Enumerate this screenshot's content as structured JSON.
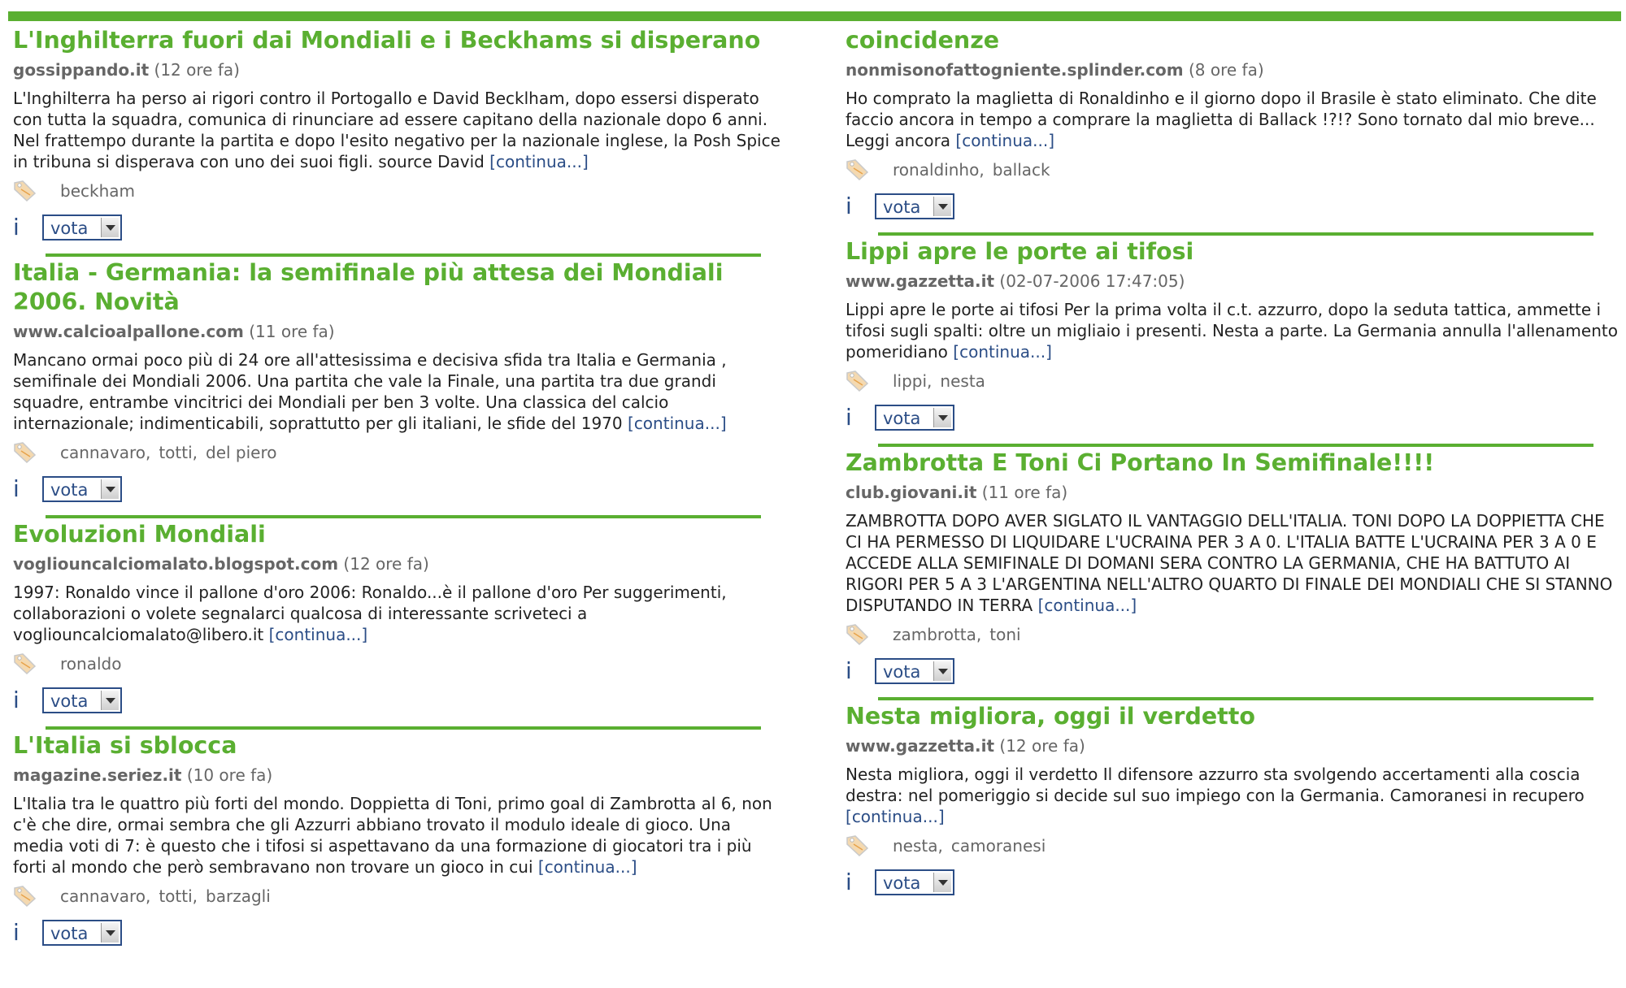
{
  "colors": {
    "accent_green": "#5aaf31",
    "link_blue": "#2b4d86",
    "meta_gray": "#666666"
  },
  "labels": {
    "info_icon": "i",
    "vota": "vota",
    "continua": "continua..."
  },
  "left_column": [
    {
      "title": "L'Inghilterra fuori dai Mondiali e i Beckhams si disperano",
      "source": "gossippando.it",
      "time": "(12 ore fa)",
      "body": "L'Inghilterra ha perso ai rigori contro il Portogallo e David Becklham, dopo essersi disperato con tutta la squadra, comunica di rinunciare ad essere capitano della nazionale dopo 6 anni. Nel frattempo durante la partita e dopo l'esito negativo per la nazionale inglese, la Posh Spice in tribuna si disperava con uno dei suoi figli. source David ",
      "tags": [
        "beckham"
      ]
    },
    {
      "title": "Italia - Germania: la semifinale più attesa dei Mondiali 2006. Novità",
      "source": "www.calcioalpallone.com",
      "time": "(11 ore fa)",
      "body": "Mancano ormai poco più di 24 ore all'attesissima e decisiva sfida tra Italia e Germania , semifinale dei Mondiali 2006. Una partita che vale la Finale, una partita tra due grandi squadre, entrambe vincitrici dei Mondiali per ben 3 volte. Una classica del calcio internazionale; indimenticabili, soprattutto per gli italiani, le sfide del 1970 ",
      "tags": [
        "cannavaro,",
        "totti,",
        "del piero"
      ]
    },
    {
      "title": "Evoluzioni Mondiali",
      "source": "vogliouncalciomalato.blogspot.com",
      "time": "(12 ore fa)",
      "body": "1997: Ronaldo vince il pallone d'oro 2006: Ronaldo...è il pallone d'oro Per suggerimenti, collaborazioni o volete segnalarci qualcosa di interessante scriveteci a vogliouncalciomalato@libero.it ",
      "tags": [
        "ronaldo"
      ]
    },
    {
      "title": "L'Italia si sblocca",
      "source": "magazine.seriez.it",
      "time": "(10 ore fa)",
      "body": "L'Italia tra le quattro più forti del mondo. Doppietta di Toni, primo goal di Zambrotta al 6, non c'è che dire, ormai sembra che gli Azzurri abbiano trovato il modulo ideale di gioco. Una media voti di 7: è questo che i tifosi si aspettavano da una formazione di giocatori tra i più forti al mondo che però sembravano non trovare un gioco in cui ",
      "tags": [
        "cannavaro,",
        "totti,",
        "barzagli"
      ]
    }
  ],
  "right_column": [
    {
      "title": "coincidenze",
      "source": "nonmisonofattogniente.splinder.com",
      "time": "(8 ore fa)",
      "body": "Ho comprato la maglietta di Ronaldinho e il giorno dopo il Brasile è stato eliminato. Che dite faccio ancora in tempo a comprare la maglietta di Ballack !?!? Sono tornato dal mio breve... Leggi ancora ",
      "tags": [
        "ronaldinho,",
        "ballack"
      ]
    },
    {
      "title": "Lippi apre le porte ai tifosi",
      "source": "www.gazzetta.it",
      "time": "(02-07-2006 17:47:05)",
      "body": "Lippi apre le porte ai tifosi Per la prima volta il c.t. azzurro, dopo la seduta tattica, ammette i tifosi sugli spalti: oltre un migliaio i presenti. Nesta a parte. La Germania annulla l'allenamento pomeridiano ",
      "tags": [
        "lippi,",
        "nesta"
      ]
    },
    {
      "title": "Zambrotta E Toni Ci Portano In Semifinale!!!!",
      "source": "club.giovani.it",
      "time": "(11 ore fa)",
      "body": "ZAMBROTTA DOPO AVER SIGLATO IL VANTAGGIO DELL'ITALIA. TONI DOPO LA DOPPIETTA CHE CI HA PERMESSO DI LIQUIDARE L'UCRAINA PER 3 A 0. L'ITALIA BATTE L'UCRAINA PER 3 A 0 E ACCEDE ALLA SEMIFINALE DI DOMANI SERA CONTRO LA GERMANIA, CHE HA BATTUTO AI RIGORI PER 5 A 3 L'ARGENTINA NELL'ALTRO QUARTO DI FINALE DEI MONDIALI CHE SI STANNO DISPUTANDO IN TERRA ",
      "tags": [
        "zambrotta,",
        "toni"
      ]
    },
    {
      "title": "Nesta migliora, oggi il verdetto",
      "source": "www.gazzetta.it",
      "time": "(12 ore fa)",
      "body": "Nesta migliora, oggi il verdetto Il difensore azzurro sta svolgendo accertamenti alla coscia destra: nel pomeriggio si decide sul suo impiego con la Germania. Camoranesi in recupero ",
      "tags": [
        "nesta,",
        "camoranesi"
      ]
    }
  ]
}
